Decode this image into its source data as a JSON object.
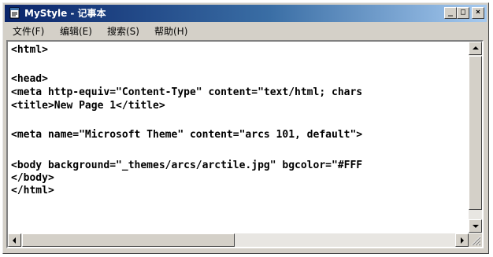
{
  "window": {
    "title": "MyStyle - 记事本"
  },
  "caption_buttons": {
    "minimize": "_",
    "maximize": "□",
    "close": "×"
  },
  "menu": [
    {
      "label": "文件(F)"
    },
    {
      "label": "编辑(E)"
    },
    {
      "label": "搜索(S)"
    },
    {
      "label": "帮助(H)"
    }
  ],
  "editor": {
    "lines": [
      "<html>",
      "",
      "<head>",
      "<meta http-equiv=\"Content-Type\" content=\"text/html; chars",
      "<title>New Page 1</title>",
      "",
      "<meta name=\"Microsoft Theme\" content=\"arcs 101, default\">",
      "",
      "<body background=\"_themes/arcs/arctile.jpg\" bgcolor=\"#FFF",
      "</body>",
      "</html>"
    ]
  },
  "icons": {
    "app": "notepad-icon",
    "up": "arrow-up-icon",
    "down": "arrow-down-icon",
    "left": "arrow-left-icon",
    "right": "arrow-right-icon"
  }
}
